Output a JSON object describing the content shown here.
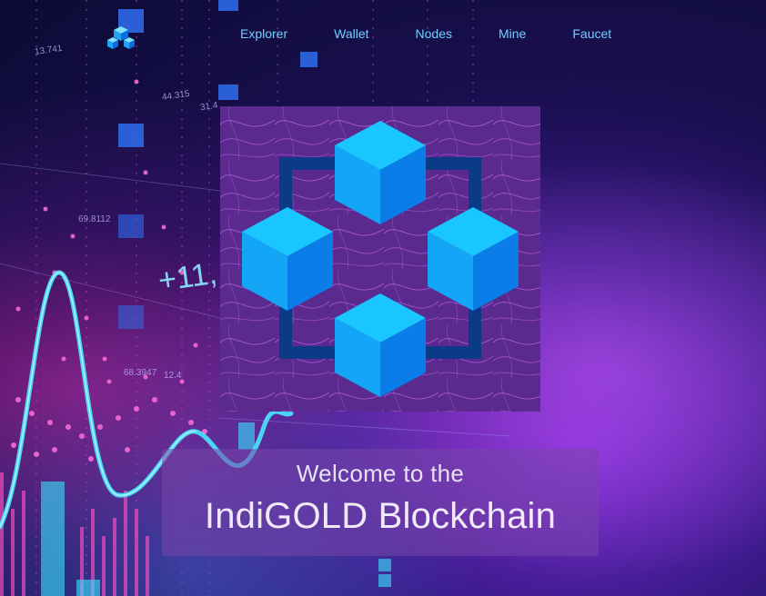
{
  "nav": {
    "items": [
      {
        "label": "Explorer"
      },
      {
        "label": "Wallet"
      },
      {
        "label": "Nodes"
      },
      {
        "label": "Mine"
      },
      {
        "label": "Faucet"
      }
    ]
  },
  "hero": {
    "welcome_line": "Welcome to the",
    "title": "IndiGOLD Blockchain"
  },
  "background_text": {
    "plus_value": "+11,",
    "numbers": [
      "13.741",
      "44.315",
      "31.4",
      "69.8112",
      "68.3947",
      "12.4"
    ]
  },
  "colors": {
    "nav_link": "#6fd0ff",
    "cube_light": "#19c6ff",
    "cube_dark": "#0a7de8",
    "frame": "#0b3a86",
    "hero_bg": "#5b2a8e"
  }
}
